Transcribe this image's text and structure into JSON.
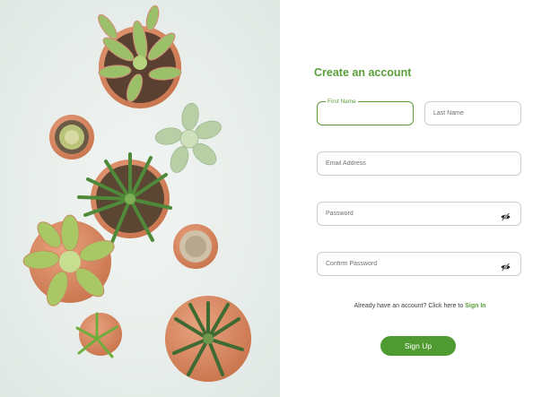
{
  "form": {
    "title": "Create an account",
    "first_name": {
      "label": "First Name",
      "value": ""
    },
    "last_name": {
      "placeholder": "Last Name"
    },
    "email": {
      "placeholder": "Email Address"
    },
    "password": {
      "placeholder": "Password",
      "toggle_icon": "eye-slash-icon"
    },
    "confirm_password": {
      "placeholder": "Confirm Password",
      "toggle_icon": "eye-slash-icon"
    },
    "signin_prompt": "Already have an account? Click here to",
    "signin_link": "Sign In",
    "submit_label": "Sign Up"
  },
  "colors": {
    "accent": "#5a9e3a",
    "button": "#4f9a31",
    "hero_background": "#e9efec"
  }
}
